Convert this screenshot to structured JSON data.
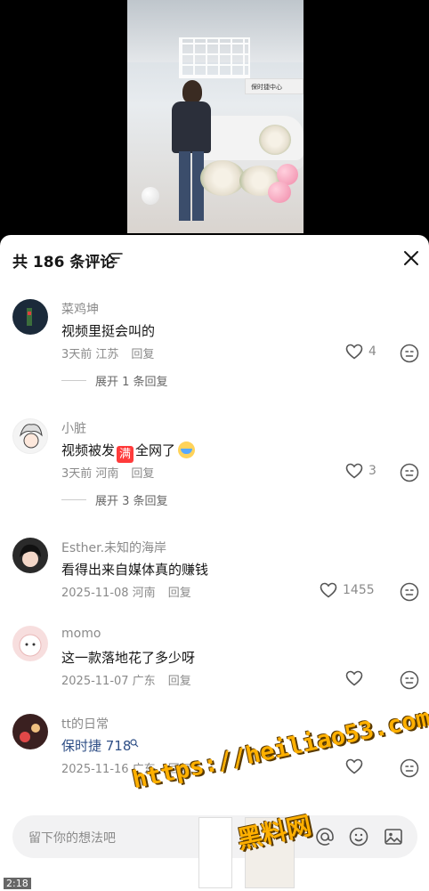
{
  "video": {
    "sign_text": "保时捷中心"
  },
  "header": {
    "count": "共 186 条评论",
    "filter_icon": "filter-lines-icon",
    "close_icon": "close-icon"
  },
  "comments": [
    {
      "username": "菜鸡坤",
      "text": "视频里挺会叫的",
      "meta": "3天前 江苏",
      "reply": "回复",
      "likes": "4",
      "expand": "展开 1 条回复",
      "avatar_color": "#1b2a3a"
    },
    {
      "username": "小脏",
      "text_before": "视频被发",
      "text_emoji": "满",
      "text_after": "全网了",
      "meta": "3天前 河南",
      "reply": "回复",
      "likes": "3",
      "expand": "展开 3 条回复",
      "avatar_color": "#f0f0f0"
    },
    {
      "username": "Esther.未知的海岸",
      "text": "看得出来自媒体真的赚钱",
      "meta": "2025-11-08 河南",
      "reply": "回复",
      "likes": "1455",
      "avatar_color": "#2a2a2a"
    },
    {
      "username": "momo",
      "text": "这一款落地花了多少呀",
      "meta": "2025-11-07 广东",
      "reply": "回复",
      "likes": "",
      "avatar_color": "#f7dede"
    },
    {
      "username": "tt的日常",
      "text": "保时捷 718",
      "text_link_color": "#2f4f86",
      "meta": "2025-11-16 广东",
      "reply": "回复",
      "likes": "",
      "avatar_color": "#3a2020"
    }
  ],
  "input": {
    "placeholder": "留下你的想法吧"
  },
  "watermark": {
    "url": "https://heiliao53.com",
    "name": "黑料网"
  },
  "status": {
    "time": "2:18"
  }
}
